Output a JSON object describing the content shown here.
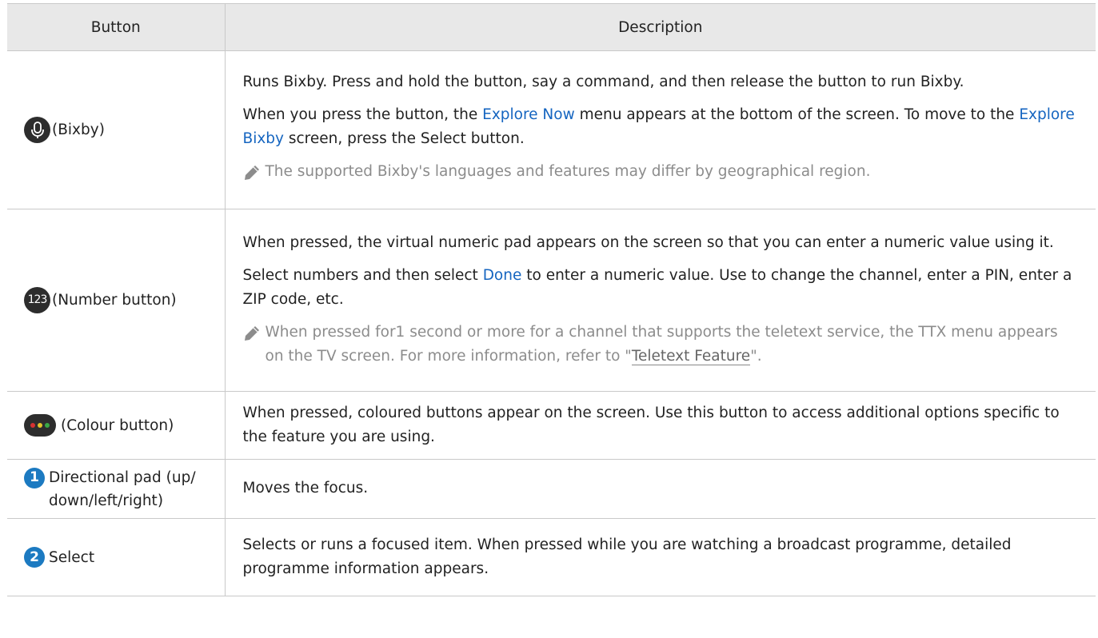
{
  "table": {
    "headers": {
      "button": "Button",
      "description": "Description"
    },
    "rows": [
      {
        "button_label": "(Bixby)",
        "desc_1": "Runs Bixby. Press and hold the button, say a command, and then release the button to run Bixby.",
        "desc_2_a": "When you press the button, the ",
        "desc_2_link1": "Explore Now",
        "desc_2_b": " menu appears at the bottom of the screen. To move to the ",
        "desc_2_link2": "Explore Bixby",
        "desc_2_c": " screen, press the Select button.",
        "note": "The supported Bixby's languages and features may differ by geographical region."
      },
      {
        "icon_text": "123",
        "button_label": "(Number button)",
        "desc_1": "When pressed, the virtual numeric pad appears on the screen so that you can enter a numeric value using it.",
        "desc_2_a": "Select numbers and then select ",
        "desc_2_link": "Done",
        "desc_2_b": " to enter a numeric value. Use to change the channel, enter a PIN, enter a ZIP code, etc.",
        "note_a": "When pressed for1 second or more for a channel that supports the teletext service, the TTX menu appears on the TV screen. For more information, refer to \"",
        "note_link": "Teletext Feature",
        "note_b": "\"."
      },
      {
        "button_label": "(Colour button)",
        "desc": "When pressed, coloured buttons appear on the screen. Use this button to access additional options specific to the feature you are using."
      },
      {
        "step": "1",
        "button_label": "Directional pad (up/ down/left/right)",
        "desc": "Moves the focus."
      },
      {
        "step": "2",
        "button_label": "Select",
        "desc": "Selects or runs a focused item. When pressed while you are watching a broadcast programme, detailed programme information appears."
      }
    ]
  },
  "icons": {
    "bixby": "microphone-icon",
    "number": "number-123-icon",
    "colour": "colour-dots-icon",
    "step": "step-number-icon",
    "note": "pencil-note-icon"
  },
  "colors": {
    "header_bg": "#e8e8e8",
    "link_blue": "#1565c0",
    "step_blue": "#1c7ac1",
    "note_gray": "#8c8c8c",
    "dot_red": "#d63232",
    "dot_yellow": "#e3c52b",
    "dot_green": "#3aa845"
  }
}
